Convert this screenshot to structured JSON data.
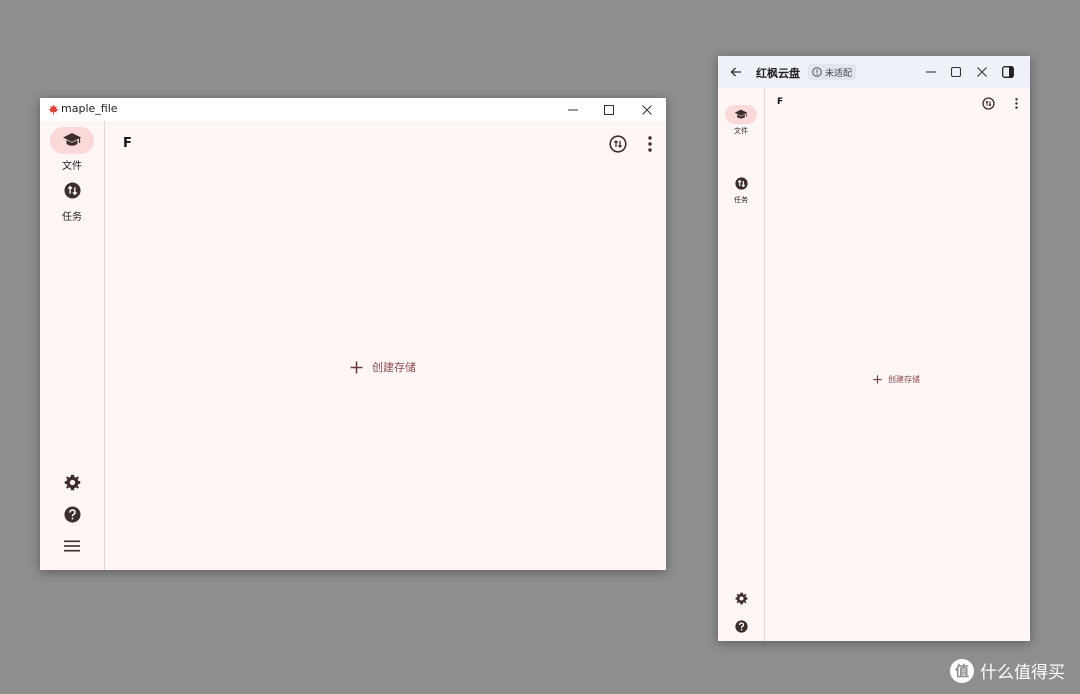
{
  "window_a": {
    "title": "maple_file",
    "header_letter": "F",
    "nav": [
      {
        "label": "文件",
        "icon": "graduation-cap-icon",
        "active": true
      },
      {
        "label": "任务",
        "icon": "swap-vertical-icon",
        "active": false
      }
    ],
    "create_label": "创建存储",
    "accent": "#fcd9d9"
  },
  "window_b": {
    "title": "红枫云盘",
    "badge": "未适配",
    "header_letter": "F",
    "nav": [
      {
        "label": "文件",
        "icon": "graduation-cap-icon",
        "active": true
      },
      {
        "label": "任务",
        "icon": "swap-vertical-icon",
        "active": false
      }
    ],
    "create_label": "创建存储"
  },
  "watermark": {
    "text": "什么值得买",
    "logo": "值"
  }
}
